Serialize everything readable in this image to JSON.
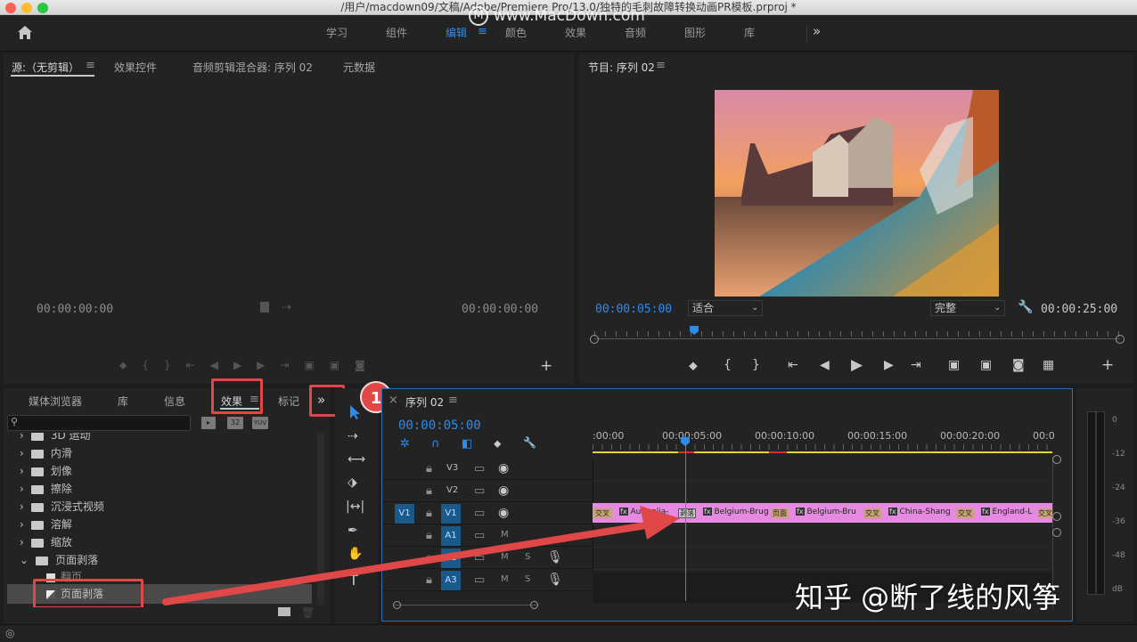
{
  "window": {
    "title": "/用户/macdown09/文稿/Adobe/Premiere Pro/13.0/独特的毛刺故障转换动画PR模板.prproj *"
  },
  "watermark_top": {
    "logo": "M",
    "text": "www.MacDown.com"
  },
  "watermark_bottom": "知乎 @断了线的风筝",
  "workspaces": [
    "学习",
    "组件",
    "编辑",
    "颜色",
    "效果",
    "音频",
    "图形",
    "库"
  ],
  "workspace_active": "编辑",
  "workspace_more": "»",
  "source_panel": {
    "tabs": [
      "源:（无剪辑）",
      "效果控件",
      "音频剪辑混合器: 序列 02",
      "元数据"
    ],
    "timecode_in": "00:00:00:00",
    "timecode_out": "00:00:00:00"
  },
  "program_panel": {
    "title": "节目: 序列 02",
    "timecode": "00:00:05:00",
    "fit": "适合",
    "quality": "完整",
    "duration": "00:00:25:00",
    "playhead_fraction": 0.19
  },
  "project_panel": {
    "tabs": [
      "媒体浏览器",
      "库",
      "信息",
      "效果",
      "标记"
    ],
    "active_tab": "效果",
    "search_placeholder": "",
    "badges": [
      "32",
      "YUV"
    ],
    "tree": [
      {
        "label": "3D 运动",
        "type": "folder",
        "expanded": false
      },
      {
        "label": "内滑",
        "type": "folder",
        "expanded": false
      },
      {
        "label": "划像",
        "type": "folder",
        "expanded": false
      },
      {
        "label": "擦除",
        "type": "folder",
        "expanded": false
      },
      {
        "label": "沉浸式视频",
        "type": "folder",
        "expanded": false
      },
      {
        "label": "溶解",
        "type": "folder",
        "expanded": false
      },
      {
        "label": "缩放",
        "type": "folder",
        "expanded": false
      },
      {
        "label": "页面剥落",
        "type": "folder",
        "expanded": true
      },
      {
        "label": "翻页",
        "type": "effect"
      },
      {
        "label": "页面剥落",
        "type": "effect",
        "selected": true
      }
    ]
  },
  "annotation": {
    "number": "1"
  },
  "timeline": {
    "sequence": "序列 02",
    "timecode": "00:00:05:00",
    "ruler_labels": [
      ":00:00",
      "00:00:05:00",
      "00:00:10:00",
      "00:00:15:00",
      "00:00:20:00",
      "00:0"
    ],
    "tracks": [
      {
        "label": "V3",
        "type": "video"
      },
      {
        "label": "V2",
        "type": "video"
      },
      {
        "label": "V1",
        "type": "video",
        "source": "V1"
      },
      {
        "label": "A1",
        "type": "audio"
      },
      {
        "label": "A2",
        "type": "audio"
      },
      {
        "label": "A3",
        "type": "audio"
      }
    ],
    "audio_flags": [
      "M",
      "S"
    ],
    "clips": [
      "Australia-",
      "Belgium-Brug",
      "Belgium-Bru",
      "China-Shang",
      "England-L"
    ],
    "transitions": [
      "交叉",
      "剥落",
      "页面",
      "交叉",
      "交叉",
      "交叉"
    ]
  },
  "meter": {
    "scale": [
      "0",
      "-12",
      "-24",
      "-36",
      "-48",
      "dB"
    ]
  },
  "colors": {
    "accent": "#2d8ceb",
    "clip": "#e58ae0",
    "transition": "#c9a27a",
    "annotation_red": "#e04848",
    "work_area": "#e5d23a"
  }
}
